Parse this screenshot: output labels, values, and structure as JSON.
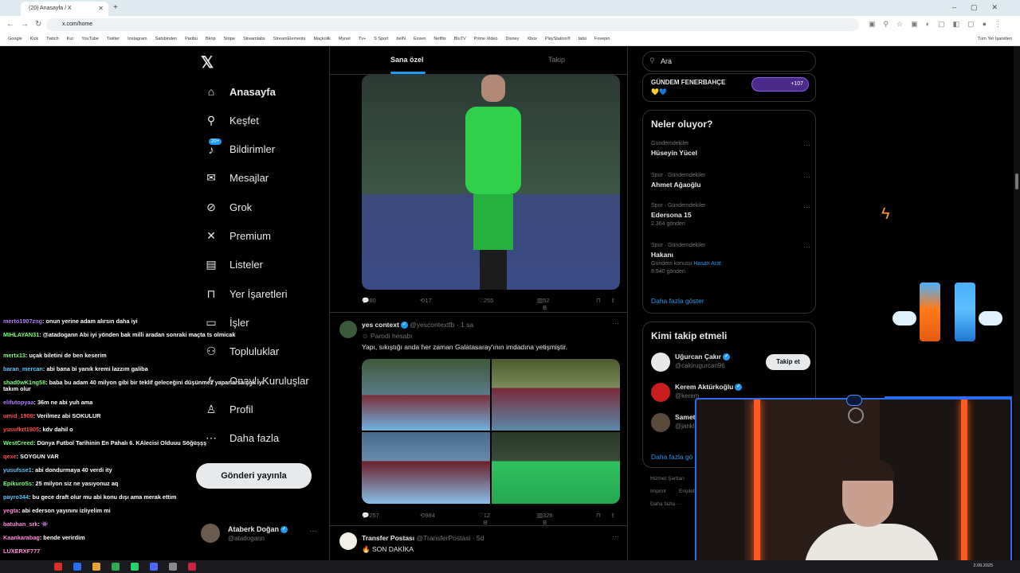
{
  "browser": {
    "tab_title": "(20) Anasayfa / X",
    "url": "x.com/home",
    "bookmarks": [
      "Google",
      "Kick",
      "Twitch",
      "Kur",
      "YouTube",
      "Twitter",
      "Instagram",
      "Sahibinden",
      "Paribu",
      "Bknp",
      "Stripe",
      "Streamlabs",
      "StreamElements",
      "Maçkolik",
      "Mynet",
      "Tv+",
      "S Sport",
      "beIN",
      "Exxen",
      "Netflix",
      "BluTV",
      "Prime Video",
      "Disney",
      "Xbox",
      "PlayStation®",
      "tabii",
      "Fovepin"
    ],
    "bookmarks_right": "Tüm Yer İşaretleri"
  },
  "nav": {
    "items": [
      {
        "label": "Anasayfa",
        "icon": "home-icon",
        "glyph": "⌂"
      },
      {
        "label": "Keşfet",
        "icon": "search-icon",
        "glyph": "⚲"
      },
      {
        "label": "Bildirimler",
        "icon": "bell-icon",
        "glyph": "♪"
      },
      {
        "label": "Mesajlar",
        "icon": "mail-icon",
        "glyph": "✉"
      },
      {
        "label": "Grok",
        "icon": "grok-icon",
        "glyph": "⊘"
      },
      {
        "label": "Premium",
        "icon": "x-icon",
        "glyph": "✕"
      },
      {
        "label": "Listeler",
        "icon": "list-icon",
        "glyph": "▤"
      },
      {
        "label": "Yer İşaretleri",
        "icon": "bookmark-icon",
        "glyph": "⊓"
      },
      {
        "label": "İşler",
        "icon": "briefcase-icon",
        "glyph": "▭"
      },
      {
        "label": "Topluluklar",
        "icon": "people-icon",
        "glyph": "⚇"
      },
      {
        "label": "Onaylı Kuruluşlar",
        "icon": "lightning-icon",
        "glyph": "ϟ"
      },
      {
        "label": "Profil",
        "icon": "person-icon",
        "glyph": "♙"
      },
      {
        "label": "Daha fazla",
        "icon": "more-icon",
        "glyph": "⋯"
      }
    ],
    "notif_badge": "20+",
    "post_button": "Gönderi yayınla",
    "profile_name": "Ataberk Doğan",
    "profile_handle": "@atadogann"
  },
  "feed": {
    "tab_foryou": "Sana özel",
    "tab_following": "Takip",
    "post1": {
      "replies": "80",
      "reposts": "17",
      "likes": "255",
      "views": "52 B"
    },
    "post2": {
      "name": "yes context",
      "handle": "@yescontextfb",
      "time": "· 1 sa",
      "label": "Parodi hesabı",
      "text": "Yapı, sıkıştığı anda her zaman Galatasaray'ının imdadına yetişmiştir.",
      "replies": "257",
      "reposts": "984",
      "likes": "12 B",
      "views": "326 B"
    },
    "post3": {
      "name": "Transfer Postası",
      "handle": "@TransferPostasi",
      "time": "· 5d",
      "text": "SON DAKİKA"
    }
  },
  "right": {
    "search_placeholder": "Ara",
    "fener_title": "GÜNDEM FENERBAHÇE",
    "fener_pill": "+107",
    "trends_title": "Neler oluyor?",
    "trends": [
      {
        "cat": "Gündemdekiler",
        "name": "Hüseyin Yücel",
        "count": ""
      },
      {
        "cat": "Spor · Gündemdekiler",
        "name": "Ahmet Ağaoğlu",
        "count": ""
      },
      {
        "cat": "Spor · Gündemdekiler",
        "name": "Edersona 15",
        "count": "2.364 gönderi"
      },
      {
        "cat": "Spor · Gündemdekiler",
        "name": "Hakanı",
        "count_prefix": "Gündem konusu",
        "count_link": "Hasan Arat",
        "count": "8.940 gönderi"
      }
    ],
    "show_more": "Daha fazla göster",
    "who_title": "Kimi takip etmeli",
    "who": [
      {
        "name": "Uğurcan Çakır",
        "handle": "@cakirugurcan96",
        "button": "Takip et"
      },
      {
        "name": "Kerem Aktürkoğlu",
        "handle": "@kerem"
      },
      {
        "name": "Samet",
        "handle": "@janki"
      }
    ],
    "who_more": "Daha fazla gö",
    "footer": [
      "Hizmet Şartları",
      "Imprint",
      "Erişileb",
      "Daha fazla ···"
    ]
  },
  "chat": [
    {
      "user": "merto1907zng",
      "color": "#b07cff",
      "msg": ": onun yerine adam alırsın daha iyi"
    },
    {
      "user": "MIHLAYAN31",
      "color": "#7dff7d",
      "msg": ": @atadogann Abi iyi yönden bak milli aradan sonraki maçta ts olmicak"
    },
    {
      "user": "mertx13",
      "color": "#7dff7d",
      "msg": ": uçak biletini de ben keserim"
    },
    {
      "user": "baran_mercan",
      "color": "#5ac8ff",
      "msg": ": abi bana bi yanık kremi lazzım galiba"
    },
    {
      "user": "shad0wK1ng58",
      "color": "#7dff7d",
      "msg": ": baba bu adam 40 milyon gibi bir teklif geleceğini düşünmez yaparlarsa çok iyi takım olur"
    },
    {
      "user": "elifutopyaa",
      "color": "#b07cff",
      "msg": ": 36m ne abi yuh ama"
    },
    {
      "user": "umid_1909",
      "color": "#ff4d4d",
      "msg": ": Verilmez abi SOKULUR"
    },
    {
      "user": "yusufkrt1905",
      "color": "#ff4d4d",
      "msg": ": kdv dahil o"
    },
    {
      "user": "WestCreed",
      "color": "#7dff7d",
      "msg": ": Dünya Futbol Tarihinin En Pahalı 6. KAlecisi Olduuu Söğüşşş"
    },
    {
      "user": "qexe",
      "color": "#ff4d4d",
      "msg": ": SOYGUN VAR"
    },
    {
      "user": "yusufsse1",
      "color": "#5ac8ff",
      "msg": ": abi dondurmaya 40 verdi ity"
    },
    {
      "user": "EpikuroSs",
      "color": "#7dff7d",
      "msg": ": 25 milyon siz ne yasıyonuz aq"
    },
    {
      "user": "payro344",
      "color": "#5ac8ff",
      "msg": ": bu gece draft olur mu abi konu dışı ama merak ettim"
    },
    {
      "user": "yegta",
      "color": "#ff8ad8",
      "msg": ": abi ederson yayınını izliyelim mi"
    },
    {
      "user": "batuhan_srk",
      "color": "#ff8ad8",
      "msg": ": 👾"
    },
    {
      "user": "Kaankarabag",
      "color": "#ff8ad8",
      "msg": ": bende verirdim"
    },
    {
      "user": "LUXERXF777",
      "color": "#ff8ad8",
      "msg": ""
    }
  ],
  "taskbar": {
    "time": "2.09.2025"
  }
}
